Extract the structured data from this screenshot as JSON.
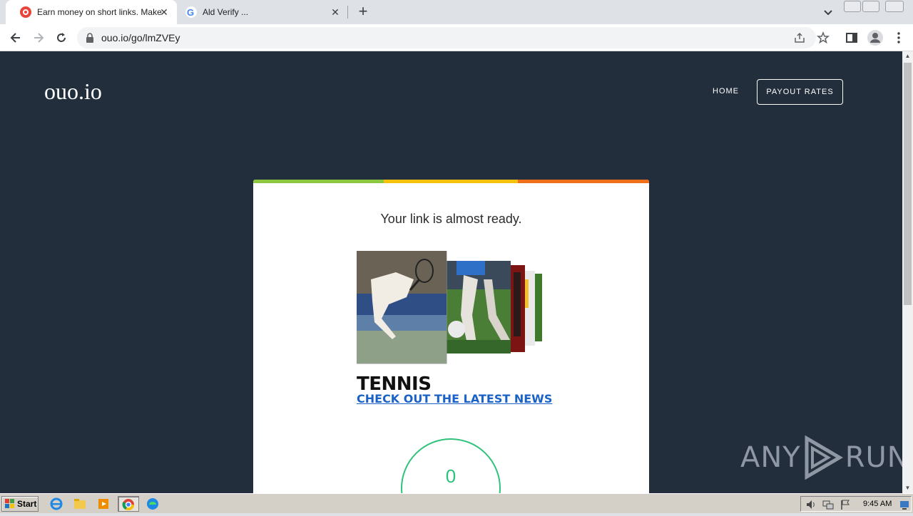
{
  "browser": {
    "tabs": [
      {
        "title": "Earn money on short links. Make sho",
        "favicon": "ouo-favicon-icon",
        "active": true
      },
      {
        "title": "Ald Verify ...",
        "favicon": "google-favicon-icon",
        "active": false
      }
    ],
    "url": "ouo.io/go/lmZVEy"
  },
  "site": {
    "logo": "ouo.io",
    "nav": {
      "home": "HOME",
      "payout": "PAYOUT RATES"
    }
  },
  "card": {
    "heading": "Your link is almost ready.",
    "stripe_colors": [
      "#8dc63f",
      "#f4c20d",
      "#f0701a"
    ],
    "ad": {
      "title": "TENNIS",
      "link": "CHECK OUT THE LATEST NEWS"
    },
    "countdown": "0"
  },
  "watermark": "ANY RUN",
  "taskbar": {
    "start": "Start",
    "clock": "9:45 AM"
  },
  "colors": {
    "page_bg": "#232e3d",
    "timer": "#2fc27b",
    "link": "#1a62c7"
  }
}
